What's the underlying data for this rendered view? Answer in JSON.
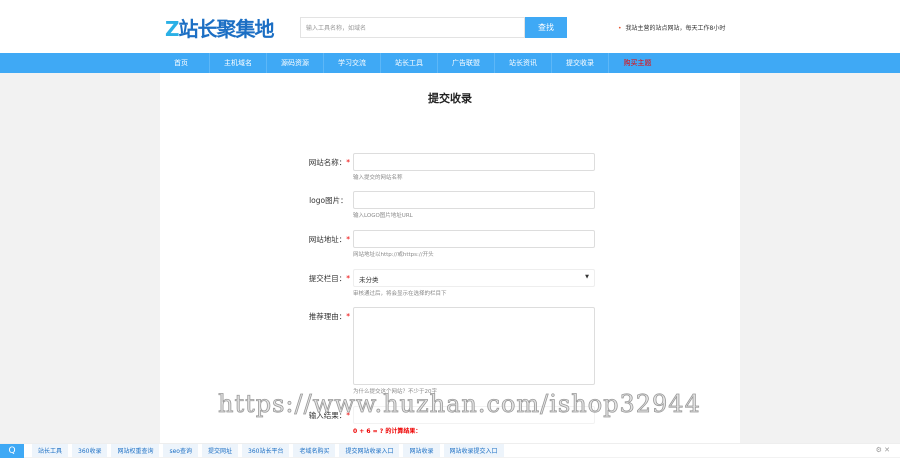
{
  "header": {
    "logo": "Z站长聚集地",
    "search_placeholder": "输入工具名称，如域名",
    "search_button": "查找",
    "notice": "我站主营的站点网站，每天工作8小时"
  },
  "nav": [
    "首页",
    "主机域名",
    "源码资源",
    "学习交流",
    "站长工具",
    "广告联盟",
    "站长资讯",
    "提交收录",
    "购买主题"
  ],
  "form": {
    "title": "提交收录",
    "fields": [
      {
        "label": "网站名称：",
        "required": true,
        "value": "",
        "hint": "输入提交的网站名称"
      },
      {
        "label": "logo图片：",
        "required": false,
        "value": "",
        "hint": "输入LOGO图片地址URL"
      },
      {
        "label": "网站地址：",
        "required": true,
        "value": "",
        "hint": "网站地址以http://或https://开头"
      },
      {
        "label": "提交栏目：",
        "required": true,
        "value": "未分类",
        "hint": "审核通过后，将会显示在选择的栏目下"
      },
      {
        "label": "推荐理由：",
        "required": true,
        "value": "",
        "hint": "为什么提交这个网站？不少于20字"
      },
      {
        "label": "输入结果：",
        "required": true,
        "value": ""
      }
    ],
    "captcha": "0 + 6 = ? 的计算结果："
  },
  "watermark": "https://www.huzhan.com/ishop32944",
  "bottom_bar": [
    "站长工具",
    "360收录",
    "网站权重查询",
    "seo查询",
    "提交网址",
    "360站长平台",
    "老域名购买",
    "提交网站收录入口",
    "网站收录",
    "网站收录提交入口"
  ]
}
